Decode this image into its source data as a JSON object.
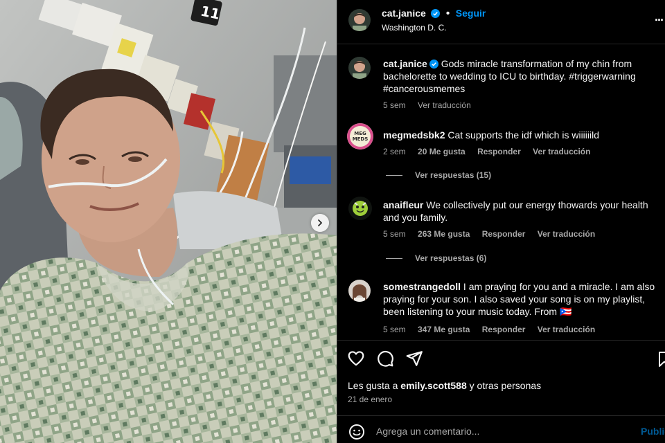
{
  "post": {
    "username": "cat.janice",
    "follow_label": "Seguir",
    "location": "Washington D. C.",
    "more_label": "..."
  },
  "photo": {
    "room_number": "11"
  },
  "caption": {
    "username": "cat.janice",
    "text": "Gods miracle transformation of my chin from bachelorette to wedding to ICU to birthday. #triggerwarning #cancerousmemes",
    "time": "5 sem",
    "translate": "Ver traducción"
  },
  "comments": [
    {
      "username": "megmedsbk2",
      "avatar_text": "MEG MEDS",
      "text": "Cat supports the idf which is wiiiiiild",
      "time": "2 sem",
      "likes": "20 Me gusta",
      "reply": "Responder",
      "translate": "Ver traducción",
      "view_replies": "Ver respuestas (15)"
    },
    {
      "username": "anaifleur",
      "text": "We collectively put our energy thowards your health and you family.",
      "time": "5 sem",
      "likes": "263 Me gusta",
      "reply": "Responder",
      "translate": "Ver traducción",
      "view_replies": "Ver respuestas (6)"
    },
    {
      "username": "somestrangedoll",
      "text": "I am praying for you and a miracle. I am also praying for your son. I also saved your song is on my playlist, been listening to your music today. From 🇵🇷",
      "time": "5 sem",
      "likes": "347 Me gusta",
      "reply": "Responder",
      "translate": "Ver traducción"
    }
  ],
  "footer": {
    "likes_prefix": "Les gusta a",
    "likes_user": "emily.scott588",
    "likes_suffix": "y otras personas",
    "date": "21 de enero",
    "comment_placeholder": "Agrega un comentario...",
    "publish_label": "Publicar"
  },
  "colors": {
    "accent": "#0095f6",
    "background": "#000000",
    "secondary_text": "#a8a8a8"
  },
  "icons": [
    "verified-badge-icon",
    "heart-icon",
    "comment-icon",
    "share-icon",
    "bookmark-icon",
    "emoji-icon",
    "chevron-right-icon"
  ]
}
